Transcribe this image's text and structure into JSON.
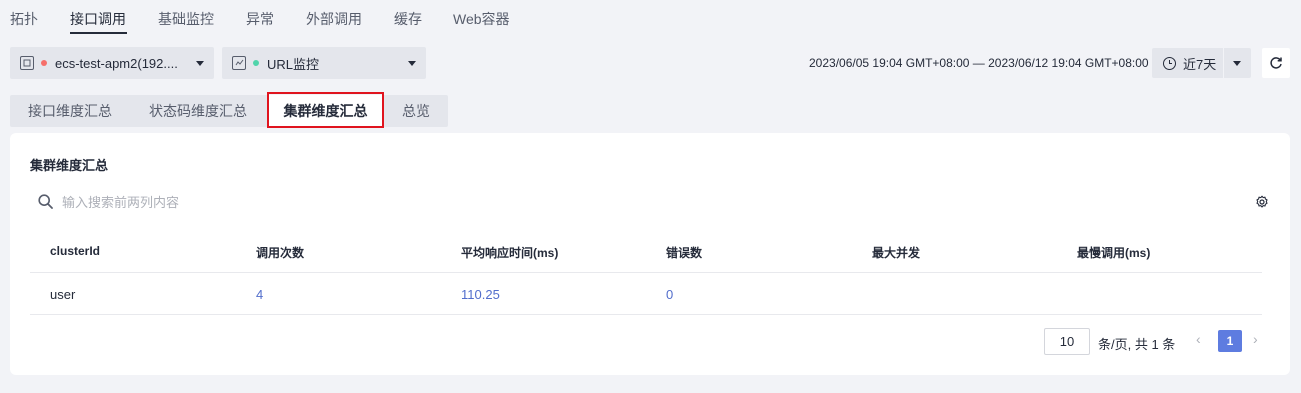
{
  "top_tabs": [
    {
      "label": "拓扑"
    },
    {
      "label": "接口调用"
    },
    {
      "label": "基础监控"
    },
    {
      "label": "异常"
    },
    {
      "label": "外部调用"
    },
    {
      "label": "缓存"
    },
    {
      "label": "Web容器"
    }
  ],
  "active_top_tab": "接口调用",
  "selectors": {
    "instance": {
      "value": "ecs-test-apm2(192....",
      "status_color": "#f66f6a",
      "icon": "server-icon"
    },
    "monitor": {
      "value": "URL监控",
      "status_color": "#50d4ab",
      "icon": "monitor-icon"
    }
  },
  "time_range": "2023/06/05 19:04 GMT+08:00 — 2023/06/12 19:04 GMT+08:00",
  "period": {
    "label": "近7天",
    "icon": "clock-icon"
  },
  "refresh_icon": "refresh-icon",
  "sub_tabs": [
    {
      "label": "接口维度汇总"
    },
    {
      "label": "状态码维度汇总"
    },
    {
      "label": "集群维度汇总"
    },
    {
      "label": "总览"
    }
  ],
  "active_sub_tab": "集群维度汇总",
  "card": {
    "title": "集群维度汇总",
    "search_placeholder": "输入搜索前两列内容",
    "columns": [
      "clusterId",
      "调用次数",
      "平均响应时间(ms)",
      "错误数",
      "最大并发",
      "最慢调用(ms)"
    ],
    "rows": [
      {
        "clusterId": "user",
        "calls": "4",
        "avg_response": "110.25",
        "errors": "0",
        "max_concurrency": "",
        "slowest": ""
      }
    ]
  },
  "pagination": {
    "page_size": "10",
    "info": "条/页, 共 1 条",
    "current_page": "1",
    "prev": "‹",
    "next": "›"
  },
  "colors": {
    "accent": "#5e7ce0",
    "link": "#526ecc",
    "highlight": "#e0141e"
  }
}
